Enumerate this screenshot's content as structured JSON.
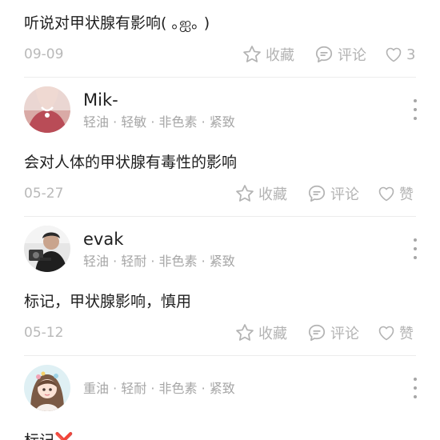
{
  "comments": [
    {
      "text": "听说对甲状腺有影响( ｡ஐ｡ )",
      "date": "09-09",
      "favorite_label": "收藏",
      "reply_label": "评论",
      "like_label": "3"
    },
    {
      "username": "Mik-",
      "skin_tags": "轻油 · 轻敏 · 非色素 · 紧致",
      "text": "会对人体的甲状腺有毒性的影响",
      "date": "05-27",
      "favorite_label": "收藏",
      "reply_label": "评论",
      "like_label": "赞"
    },
    {
      "username": "evak",
      "skin_tags": "轻油 · 轻耐 · 非色素 · 紧致",
      "text": "标记，甲状腺影响，慎用",
      "date": "05-12",
      "favorite_label": "收藏",
      "reply_label": "评论",
      "like_label": "赞"
    },
    {
      "username": "",
      "skin_tags": "重油 · 轻耐 · 非色素 · 紧致",
      "text": "标记",
      "text_suffix": "❌"
    }
  ],
  "icons": {
    "favorite": "star-outline-icon",
    "reply": "comment-bubble-icon",
    "like": "heart-outline-icon",
    "more": "vertical-ellipsis-icon"
  },
  "colors": {
    "text": "#1f1f1f",
    "muted": "#b3b3b3",
    "divider": "#ececec",
    "cross": "#e0303a"
  }
}
